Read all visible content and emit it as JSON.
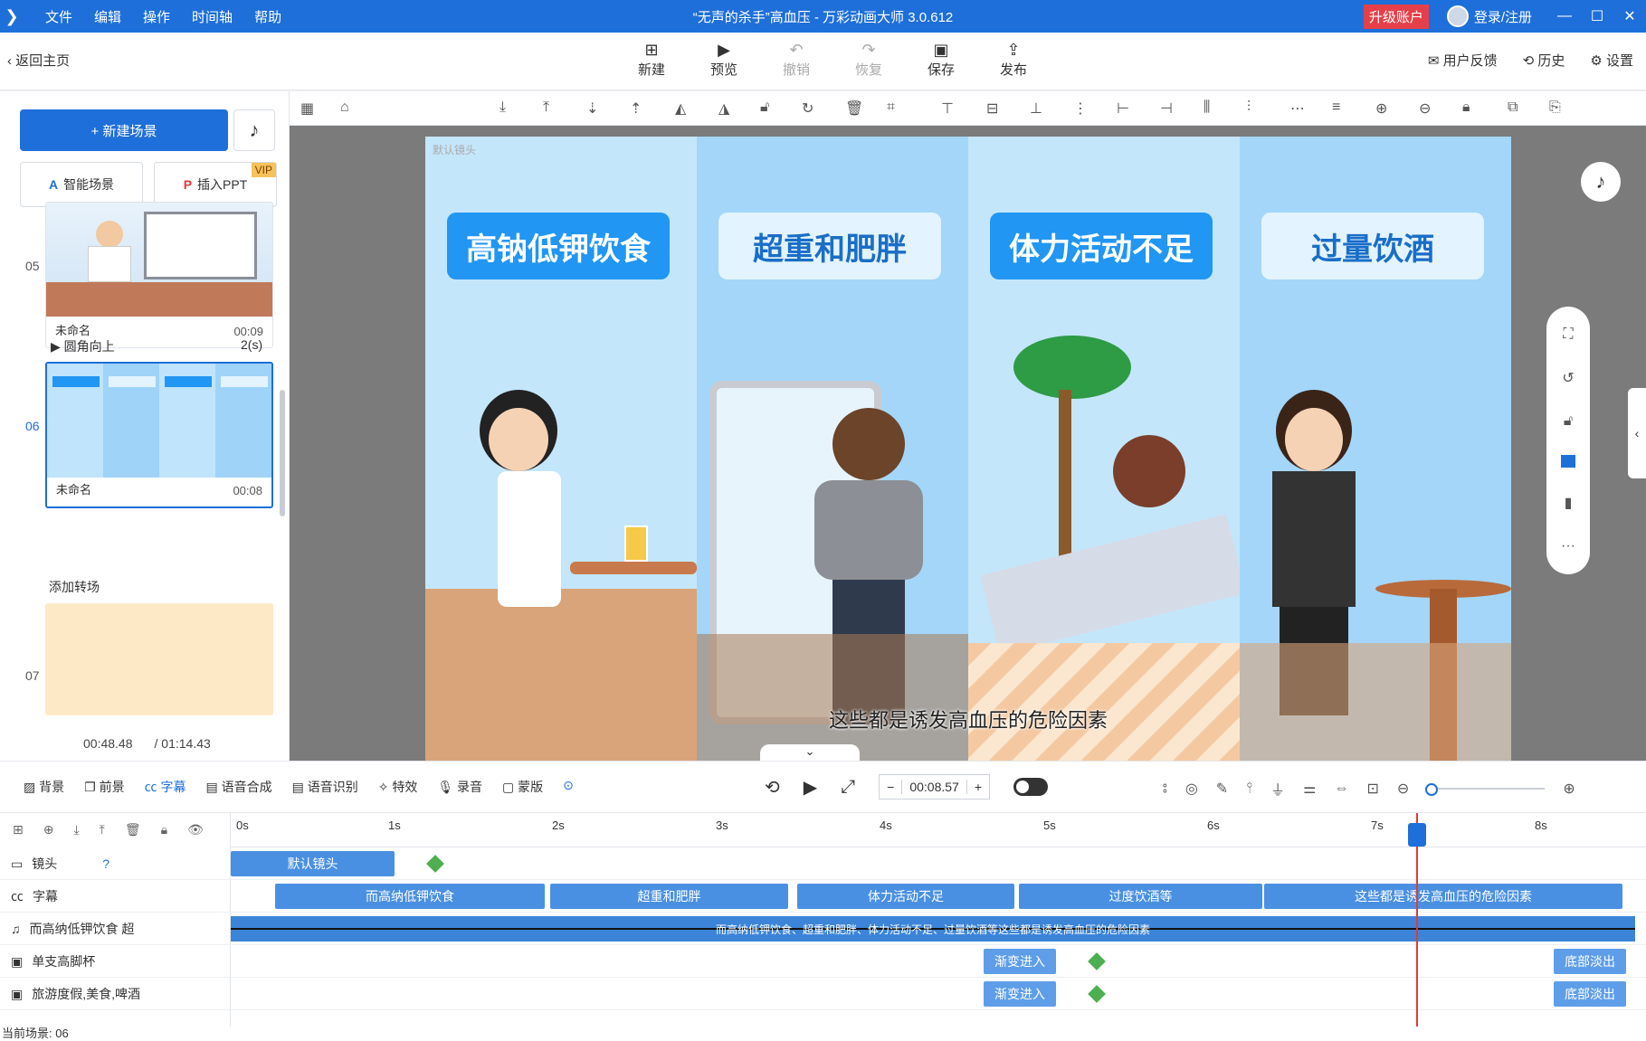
{
  "titlebar": {
    "menu": [
      "文件",
      "编辑",
      "操作",
      "时间轴",
      "帮助"
    ],
    "title": "“无声的杀手”高血压 - 万彩动画大师 3.0.612",
    "upgrade": "升级账户",
    "login": "登录/注册"
  },
  "toolbar": {
    "back": "返回主页",
    "buttons": [
      {
        "label": "新建",
        "icon": "plus-square-icon"
      },
      {
        "label": "预览",
        "icon": "play-icon"
      },
      {
        "label": "撤销",
        "icon": "undo-icon"
      },
      {
        "label": "恢复",
        "icon": "redo-icon"
      },
      {
        "label": "保存",
        "icon": "save-icon"
      },
      {
        "label": "发布",
        "icon": "publish-icon"
      }
    ],
    "right": [
      "用户反馈",
      "历史",
      "设置"
    ]
  },
  "left": {
    "new_scene": "+ 新建场景",
    "smart": "智能场景",
    "ppt": "插入PPT",
    "vip": "VIP",
    "scenes": [
      {
        "num": "05",
        "name": "未命名",
        "dur": "00:09"
      },
      {
        "num": "06",
        "name": "未命名",
        "dur": "00:08"
      },
      {
        "num": "07",
        "name": "",
        "dur": ""
      }
    ],
    "transition": {
      "label": "圆角向上",
      "value": "2(s)"
    },
    "add_transition": "添加转场",
    "current_time": "00:48.48",
    "total_time": "/ 01:14.43"
  },
  "canvas": {
    "default_cam": "默认镜头",
    "banners": [
      "高钠低钾饮食",
      "超重和肥胖",
      "体力活动不足",
      "过量饮酒"
    ],
    "subtitle": "这些都是诱发高血压的危险因素",
    "colors": {
      "accent": "#1e6fd9",
      "banner": "#2196f3"
    }
  },
  "tlbar": {
    "tools": [
      "背景",
      "前景",
      "字幕",
      "语音合成",
      "语音识别",
      "特效",
      "录音",
      "蒙版"
    ],
    "time": "00:08.57"
  },
  "timeline": {
    "ticks": [
      "0s",
      "1s",
      "2s",
      "3s",
      "4s",
      "5s",
      "6s",
      "7s",
      "8s"
    ],
    "rows": [
      {
        "label": "镜头",
        "clips": [
          "默认镜头"
        ]
      },
      {
        "label": "字幕",
        "clips": [
          "而高纳低钾饮食",
          "超重和肥胖",
          "体力活动不足",
          "过度饮酒等",
          "这些都是诱发高血压的危险因素"
        ]
      },
      {
        "label": "而高纳低钾饮食 超",
        "wave_text": "而高纳低钾饮食、超重和肥胖、体力活动不足、过量饮酒等这些都是诱发高血压的危险因素"
      },
      {
        "label": "单支高脚杯",
        "clips": [
          "渐变进入",
          "底部淡出"
        ]
      },
      {
        "label": "旅游度假,美食,啤酒",
        "clips": [
          "渐变进入",
          "底部淡出"
        ]
      }
    ]
  },
  "status": "当前场景: 06"
}
